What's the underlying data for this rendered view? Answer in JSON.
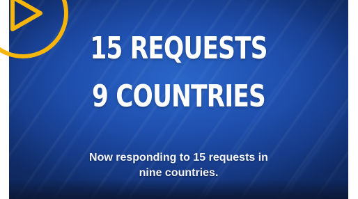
{
  "video": {
    "headline_line1": "15 REQUESTS",
    "headline_line2": "9 COUNTRIES",
    "caption_line1": "Now responding to 15 requests in",
    "caption_line2": "nine countries."
  },
  "play_button": {
    "icon": "play-icon",
    "color": "#f5b50a"
  },
  "colors": {
    "background_blue": "#1f4fae",
    "accent_yellow": "#f5b50a",
    "text": "#ffffff"
  }
}
